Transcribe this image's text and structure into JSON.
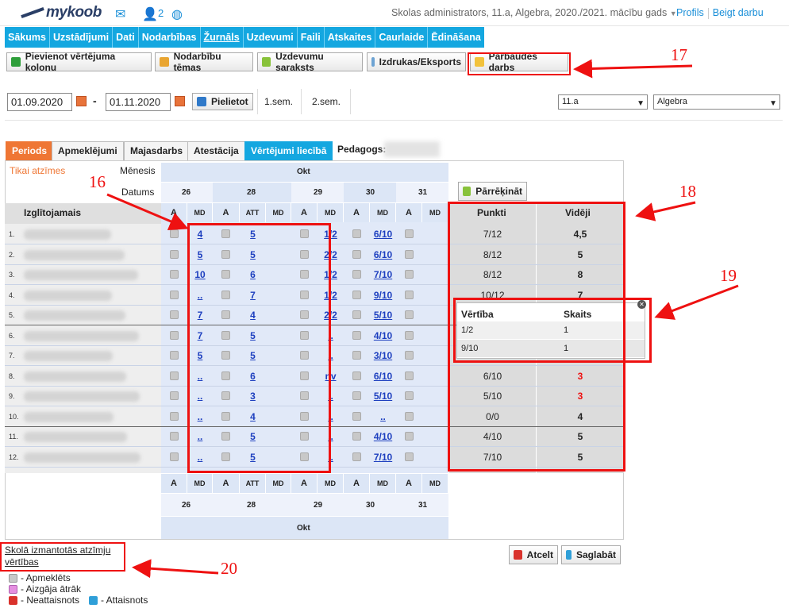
{
  "header": {
    "logo": "mykoob",
    "user_count": "2",
    "school_info": "Skolas administrators, 11.a, Algebra, 2020./2021. mācību gads",
    "profile": "Profils",
    "logout": "Beigt darbu"
  },
  "nav": [
    "Sākums",
    "Uzstādījumi",
    "Dati",
    "Nodarbības",
    "Žurnāls",
    "Uzdevumi",
    "Faili",
    "Atskaites",
    "Caurlaide",
    "Ēdināšana"
  ],
  "toolbar": {
    "add_column": "Pievienot vērtējuma kolonu",
    "topics": "Nodarbību tēmas",
    "tasks": "Uzdevumu saraksts",
    "print": "Izdrukas/Eksports",
    "test_work": "Pārbaudes darbs"
  },
  "filter": {
    "date_from": "01.09.2020",
    "dash": "-",
    "date_to": "01.11.2020",
    "apply": "Pielietot",
    "sem1": "1.sem.",
    "sem2": "2.sem.",
    "class_select": "11.a",
    "subject_select": "Algebra"
  },
  "tabs": [
    "Periods",
    "Apmeklējumi",
    "Majasdarbs",
    "Atestācija",
    "Vērtējumi liecībā"
  ],
  "teacher_label": "Pedagogs:",
  "grid": {
    "only_marks": "Tikai atzīmes",
    "month_label": "Mēnesis",
    "dates_label": "Datums",
    "month": "Okt",
    "student_header": "Izglītojamais",
    "dates": [
      "26",
      "28",
      "29",
      "30",
      "31"
    ],
    "col_types": [
      "A",
      "MD",
      "A",
      "ATT",
      "MD",
      "A",
      "MD",
      "A",
      "MD",
      "A",
      "MD"
    ],
    "recalc": "Pārrēķināt",
    "points_header": "Punkti",
    "avg_header": "Vidēji",
    "rows": [
      {
        "n": "1.",
        "md26": "4",
        "att28": "5",
        "md29": "1/2",
        "md30": "6/10",
        "points": "7/12",
        "avg": "4,5"
      },
      {
        "n": "2.",
        "md26": "5",
        "att28": "5",
        "md29": "2/2",
        "md30": "6/10",
        "points": "8/12",
        "avg": "5"
      },
      {
        "n": "3.",
        "md26": "10",
        "att28": "6",
        "md29": "1/2",
        "md30": "7/10",
        "points": "8/12",
        "avg": "8"
      },
      {
        "n": "4.",
        "md26": "..",
        "att28": "7",
        "md29": "1/2",
        "md30": "9/10",
        "points": "10/12",
        "avg": "7"
      },
      {
        "n": "5.",
        "md26": "7",
        "att28": "4",
        "md29": "2/2",
        "md30": "5/10",
        "points": "",
        "avg": ""
      },
      {
        "n": "6.",
        "md26": "7",
        "att28": "5",
        "md29": "..",
        "md30": "4/10",
        "points": "",
        "avg": ""
      },
      {
        "n": "7.",
        "md26": "5",
        "att28": "5",
        "md29": "..",
        "md30": "3/10",
        "points": "",
        "avg": ""
      },
      {
        "n": "8.",
        "md26": "..",
        "att28": "6",
        "md29": "nv",
        "md30": "6/10",
        "points": "6/10",
        "avg": "3"
      },
      {
        "n": "9.",
        "md26": "..",
        "att28": "3",
        "md29": "..",
        "md30": "5/10",
        "points": "5/10",
        "avg": "3"
      },
      {
        "n": "10.",
        "md26": "..",
        "att28": "4",
        "md29": "..",
        "md30": "..",
        "points": "0/0",
        "avg": "4"
      },
      {
        "n": "11.",
        "md26": "..",
        "att28": "5",
        "md29": "..",
        "md30": "4/10",
        "points": "4/10",
        "avg": "5"
      },
      {
        "n": "12.",
        "md26": "..",
        "att28": "5",
        "md29": "..",
        "md30": "7/10",
        "points": "7/10",
        "avg": "5"
      }
    ]
  },
  "popup": {
    "col1": "Vērtība",
    "col2": "Skaits",
    "rows": [
      [
        "1/2",
        "1"
      ],
      [
        "9/10",
        "1"
      ]
    ]
  },
  "footer": {
    "marks_link": "Skolā izmantotās atzīmju vērtības",
    "cancel": "Atcelt",
    "save": "Saglabāt",
    "legend": {
      "present": "- Apmeklēts",
      "left_early": "- Aizgāja ātrāk",
      "unexcused": "- Neattaisnots",
      "excused": "- Attaisnots"
    }
  },
  "annotations": [
    "16",
    "17",
    "18",
    "19",
    "20"
  ],
  "colors": {
    "nav": "#14a7e0",
    "tab_active": "#ef7634",
    "annotation": "#ee1111",
    "link": "#1d3fbf"
  }
}
